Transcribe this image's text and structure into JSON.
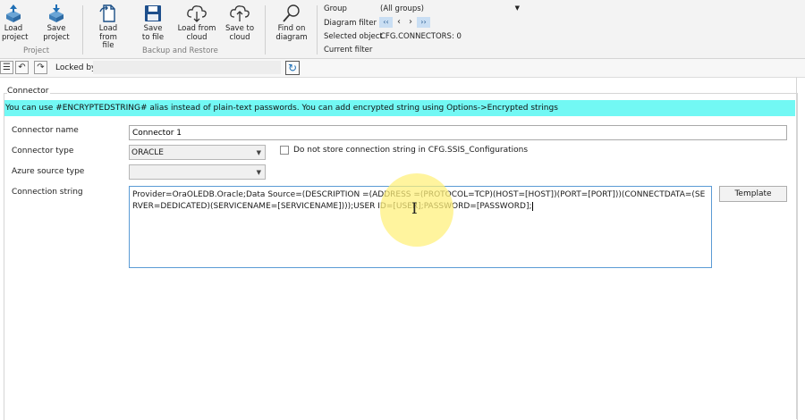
{
  "ribbon": {
    "buttons": {
      "load_project": "Load\nproject",
      "save_project": "Save\nproject",
      "load_from_file": "Load from\nfile",
      "save_to_file": "Save\nto file",
      "load_from_cloud": "Load from\ncloud",
      "save_to_cloud": "Save to\ncloud",
      "find_on_diagram": "Find on\ndiagram"
    },
    "groups": {
      "project": "Project",
      "backup_restore": "Backup and Restore"
    },
    "filters": {
      "group_label": "Group",
      "group_value": "(All groups)",
      "diagram_filter_label": "Diagram filter",
      "nav_first": "‹‹",
      "nav_prev": "‹",
      "nav_next": "›",
      "nav_last": "››",
      "selected_object_label": "Selected object",
      "selected_object_value": "CFG.CONNECTORS: 0",
      "current_filter_label": "Current filter"
    }
  },
  "toolbar": {
    "menu_icon": "☰",
    "undo_icon": "↶",
    "redo_icon": "↷",
    "locked_by_label": "Locked by",
    "locked_by_value": "",
    "refresh_icon": "↻"
  },
  "connector": {
    "section_title": "Connector",
    "banner": "You can use #ENCRYPTEDSTRING# alias instead of plain-text passwords. You can add encrypted string using Options->Encrypted strings",
    "name_label": "Connector name",
    "name_value": "Connector 1",
    "type_label": "Connector type",
    "type_value": "ORACLE",
    "no_store_label": "Do not store connection string in CFG.SSIS_Configurations",
    "azure_label": "Azure source type",
    "azure_value": "",
    "connection_label": "Connection string",
    "connection_value": "Provider=OraOLEDB.Oracle;Data Source=(DESCRIPTION =(ADDRESS =(PROTOCOL=TCP)(HOST=[HOST])(PORT=[PORT]))(CONNECTDATA=(SERVER=DEDICATED)(SERVICENAME=[SERVICENAME])));USER ID=[USER];PASSWORD=[PASSWORD];",
    "template_button": "Template"
  },
  "colors": {
    "banner_bg": "#72f8f4",
    "icon_blue": "#1f6fb5",
    "focus_border": "#5b9bd5"
  }
}
